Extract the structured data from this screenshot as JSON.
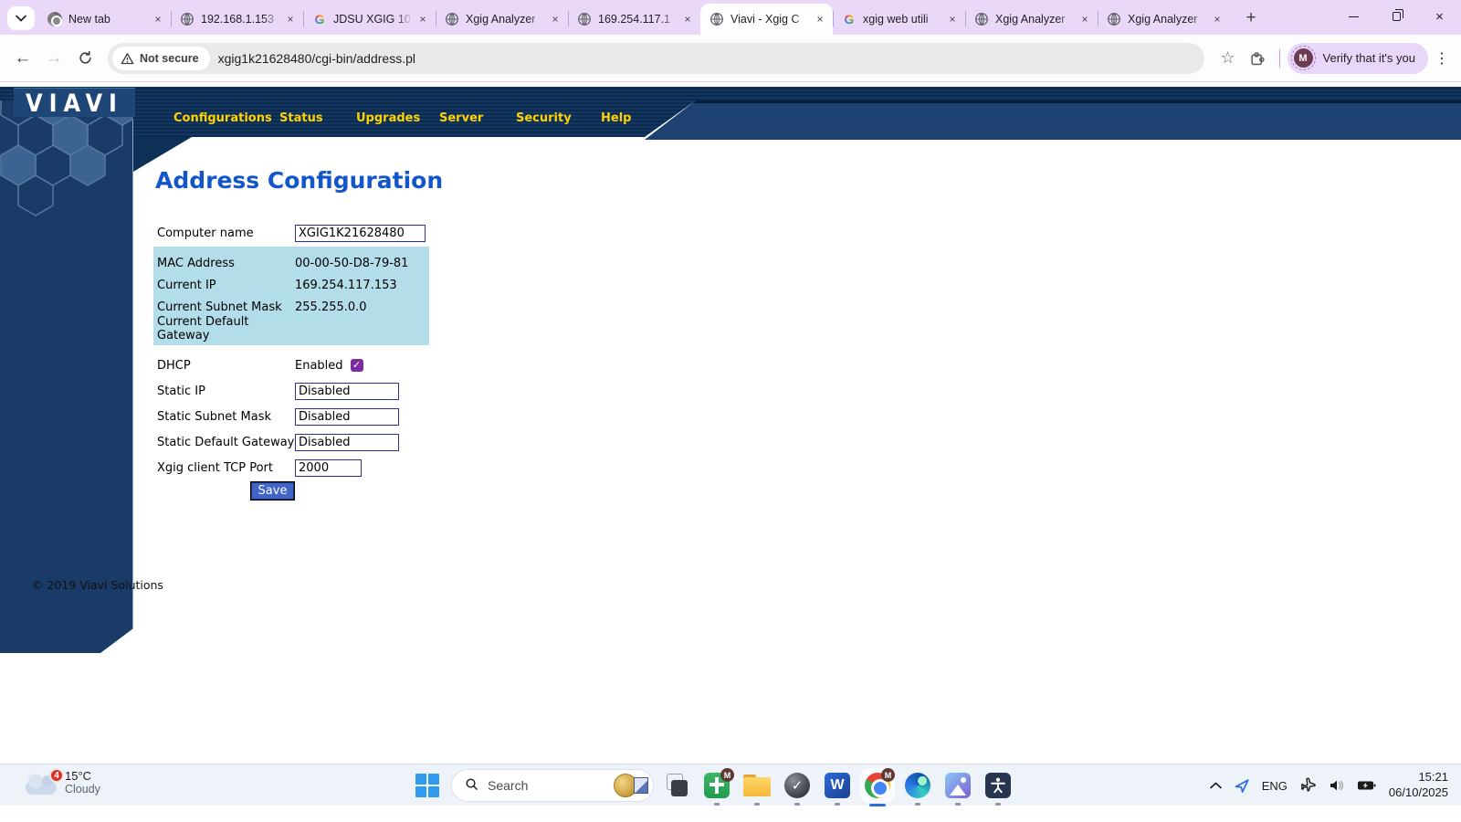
{
  "browser": {
    "tabs": [
      {
        "title": "New tab",
        "icon": "chrome-grey",
        "active": false
      },
      {
        "title": "192.168.1.153",
        "icon": "globe",
        "active": false
      },
      {
        "title": "JDSU XGIG 10",
        "icon": "google",
        "active": false
      },
      {
        "title": "Xgig Analyzer",
        "icon": "globe",
        "active": false
      },
      {
        "title": "169.254.117.1",
        "icon": "globe",
        "active": false
      },
      {
        "title": "Viavi - Xgig C",
        "icon": "globe",
        "active": true
      },
      {
        "title": "xgig web utili",
        "icon": "google",
        "active": false
      },
      {
        "title": "Xgig Analyzer",
        "icon": "globe",
        "active": false
      },
      {
        "title": "Xgig Analyzer",
        "icon": "globe",
        "active": false
      }
    ],
    "new_tab_label": "+",
    "toolbar": {
      "security_chip": "Not secure",
      "url": "xgig1k21628480/cgi-bin/address.pl",
      "profile_label": "Verify that it's you",
      "profile_initial": "M",
      "kebab": "⋮",
      "star": "☆",
      "back": "←",
      "forward": "→"
    }
  },
  "page": {
    "logo": "VIAVI",
    "nav": [
      "Configurations",
      "Status",
      "Upgrades",
      "Server",
      "Security",
      "Help"
    ],
    "title": "Address Configuration",
    "fields": {
      "computer_name": {
        "label": "Computer name",
        "value": "XGIG1K21628480"
      },
      "mac": {
        "label": "MAC Address",
        "value": "00-00-50-D8-79-81"
      },
      "current_ip": {
        "label": "Current IP",
        "value": "169.254.117.153"
      },
      "subnet": {
        "label": "Current Subnet Mask",
        "value": "255.255.0.0"
      },
      "gateway": {
        "label": "Current Default Gateway",
        "value": ""
      },
      "dhcp": {
        "label": "DHCP",
        "status": "Enabled",
        "checked": true,
        "checkmark": "✓"
      },
      "static_ip": {
        "label": "Static IP",
        "value": "Disabled"
      },
      "static_mask": {
        "label": "Static Subnet Mask",
        "value": "Disabled"
      },
      "static_gateway": {
        "label": "Static Default Gateway",
        "value": "Disabled"
      },
      "tcp_port": {
        "label": "Xgig client TCP Port",
        "value": "2000"
      }
    },
    "save_label": "Save",
    "footer": "© 2019 Viavi Solutions"
  },
  "taskbar": {
    "weather": {
      "badge": "4",
      "temp": "15°C",
      "condition": "Cloudy"
    },
    "search": {
      "placeholder": "Search"
    },
    "word_initial": "W",
    "check_glyph": "✓",
    "tray": {
      "lang": "ENG",
      "time": "15:21",
      "date": "06/10/2025"
    }
  },
  "colors": {
    "tabstrip_bg": "#e9d8f7",
    "header_navy_dark": "#0c2d55",
    "header_navy_light": "#1d4170",
    "nav_link": "#ffd200",
    "title_blue": "#1356c9",
    "panel_blue": "#b2dde9",
    "checkbox_purple": "#7b2da0",
    "save_blue": "#4164c8",
    "taskbar_bg": "#eef2f9"
  }
}
